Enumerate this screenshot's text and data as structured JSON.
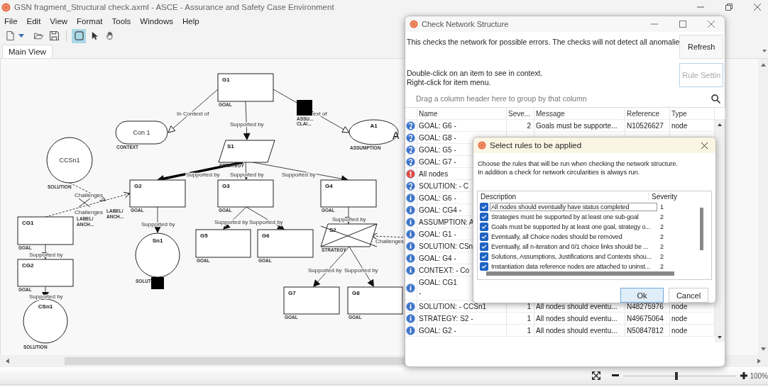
{
  "window": {
    "title": "GSN fragment_Structural check.axml - ASCE - Assurance and Safety Case Environment"
  },
  "menu": [
    "File",
    "Edit",
    "View",
    "Format",
    "Tools",
    "Windows",
    "Help"
  ],
  "toolbar": [
    {
      "kind": "new",
      "selected": false
    },
    {
      "kind": "open",
      "selected": false
    },
    {
      "kind": "save",
      "selected": false
    },
    {
      "kind": "rectangle",
      "selected": true
    },
    {
      "kind": "pointer",
      "selected": false
    },
    {
      "kind": "hand",
      "selected": false
    }
  ],
  "tabs": [
    {
      "label": "Main View",
      "selected": true
    }
  ],
  "diagram": {
    "nodes": [
      {
        "kind": "goal",
        "id": "G1",
        "type": "GOAL",
        "struck": false
      },
      {
        "kind": "context",
        "id": "Con 1",
        "type": "CONTEXT",
        "struck": false
      },
      {
        "kind": "marker",
        "lines": [
          "ASSU...",
          "CLAI..."
        ],
        "struck": false
      },
      {
        "kind": "assumption",
        "id": "A1",
        "type": "ASSUMPTION",
        "mark": "A",
        "struck": false
      },
      {
        "kind": "strategy",
        "id": "S1",
        "type": "STRATEGY",
        "struck": false
      },
      {
        "kind": "solution_ref",
        "id": "CCSn1",
        "type": "SOLUTION",
        "struck": false
      },
      {
        "kind": "goal",
        "id": "G2",
        "type": "GOAL",
        "struck": false
      },
      {
        "kind": "goal",
        "id": "G3",
        "type": "GOAL",
        "struck": false
      },
      {
        "kind": "goal",
        "id": "G4",
        "type": "GOAL",
        "struck": false
      },
      {
        "kind": "goal",
        "id": "CG1",
        "type": "GOAL",
        "struck": false
      },
      {
        "kind": "solution",
        "id": "Sn1",
        "type": "SOLUT",
        "struck": false
      },
      {
        "kind": "goal",
        "id": "G5",
        "type": "GOAL",
        "struck": false
      },
      {
        "kind": "goal",
        "id": "G6",
        "type": "GOAL",
        "struck": false
      },
      {
        "kind": "strategy",
        "id": "S2",
        "type": "STRATEGY",
        "struck": true
      },
      {
        "kind": "goal",
        "id": "CG2",
        "type": "GOAL",
        "struck": false
      },
      {
        "kind": "marker",
        "struck": false
      },
      {
        "kind": "goal",
        "id": "G7",
        "type": "GOAL",
        "struck": false
      },
      {
        "kind": "goal",
        "id": "G8",
        "type": "GOAL",
        "struck": false
      },
      {
        "kind": "solution",
        "id": "CSn1",
        "type": "SOLUTION",
        "struck": false
      }
    ],
    "edges": [
      {
        "kind": "context",
        "label": "In Context of",
        "selected": false
      },
      {
        "kind": "context",
        "label": "ext of",
        "selected": false
      },
      {
        "kind": "support",
        "label": "Supported by",
        "selected": false
      },
      {
        "kind": "support",
        "label": "Supported by",
        "selected": true
      },
      {
        "kind": "support",
        "label": "Supported by",
        "selected": false
      },
      {
        "kind": "support",
        "label": "Supported by",
        "selected": false
      },
      {
        "kind": "support",
        "label": "Supported by",
        "selected": false
      },
      {
        "kind": "support",
        "label": "Supported by",
        "selected": false
      },
      {
        "kind": "support",
        "label": "Supported by",
        "selected": false
      },
      {
        "kind": "support",
        "label": "Supported by",
        "selected": false
      },
      {
        "kind": "support",
        "label": "Supported by",
        "selected": false
      },
      {
        "kind": "support",
        "label": "Supported by",
        "selected": false
      },
      {
        "kind": "support",
        "label": "Supported by",
        "selected": false
      },
      {
        "kind": "support",
        "label": "Supported by",
        "selected": false
      },
      {
        "kind": "challenge",
        "label": "Challenges",
        "selected": false
      },
      {
        "kind": "challenge",
        "label": "Challenges",
        "selected": false
      },
      {
        "kind": "challenge",
        "label": "Challenges",
        "selected": false
      }
    ],
    "anchors": [
      {
        "lines": [
          "LABEL/",
          "ANCH..."
        ]
      },
      {
        "lines": [
          "LABEL/",
          "ANCH..."
        ]
      }
    ]
  },
  "check_dialog": {
    "title": "Check Network Structure",
    "intro": "This checks the network for possible errors. The checks will not detect all anomalie",
    "help": [
      "Double-click on an item to see in context.",
      "Right-click for item menu."
    ],
    "buttons": [
      {
        "label": "Refresh",
        "disabled": false
      },
      {
        "label": "Rule Settin",
        "disabled": true
      }
    ],
    "group_hint": "Drag a column header here to group by that column",
    "columns": [
      "Name",
      "Seve...",
      "Message",
      "Reference",
      "Type"
    ],
    "rows": [
      {
        "kind": "question",
        "name": "GOAL: G6 -",
        "severity": "2",
        "message": "Goals must be supporte...",
        "reference": "N10526627",
        "type": "node"
      },
      {
        "kind": "question",
        "name": "GOAL: G8 -"
      },
      {
        "kind": "question",
        "name": "GOAL: G5 -"
      },
      {
        "kind": "question",
        "name": "GOAL: G7 -"
      },
      {
        "kind": "error",
        "name": "All nodes"
      },
      {
        "kind": "question",
        "name": "SOLUTION:  - C"
      },
      {
        "kind": "info",
        "name": "GOAL: G6 -"
      },
      {
        "kind": "info",
        "name": "GOAL: CG4 -"
      },
      {
        "kind": "info",
        "name": "ASSUMPTION: A"
      },
      {
        "kind": "info",
        "name": "GOAL: G1 -"
      },
      {
        "kind": "info",
        "name": "SOLUTION: CSn"
      },
      {
        "kind": "info",
        "name": "GOAL: G4 -"
      },
      {
        "kind": "info",
        "name": "CONTEXT:  - Co"
      },
      {
        "kind": "info",
        "name": "GOAL: CG1",
        "name_2": "-"
      },
      {
        "kind": "info",
        "name": "SOLUTION:  - CCSn1",
        "severity": "1",
        "message": "All nodes should eventu...",
        "reference": "N48275976",
        "type": "node"
      },
      {
        "kind": "info",
        "name": "STRATEGY: S2 -",
        "severity": "1",
        "message": "All nodes should eventu...",
        "reference": "N49675064",
        "type": "node"
      },
      {
        "kind": "info",
        "name": "GOAL: G2 -",
        "severity": "1",
        "message": "All nodes should eventu...",
        "reference": "N50847812",
        "type": "node"
      }
    ]
  },
  "rules_dialog": {
    "title": "Select rules to be applied",
    "intro": [
      "Choose the rules that will be run when checking the network structure.",
      "In addition a check for network circularities is always run."
    ],
    "columns": [
      "Description",
      "Severity"
    ],
    "rules": [
      {
        "checked": true,
        "description": "All nodes should eventually have status completed",
        "severity": "1",
        "selected": true
      },
      {
        "checked": true,
        "description": "Strategies must be supported by at least one sub-goal",
        "severity": "2",
        "selected": false
      },
      {
        "checked": true,
        "description": "Goals must be supported by at least one goal, strategy o...",
        "severity": "2",
        "selected": false
      },
      {
        "checked": true,
        "description": "Eventually, all Choice nodes should be removed",
        "severity": "2",
        "selected": false
      },
      {
        "checked": true,
        "description": "Eventually, all n-iteration and 0/1 choice links should be ...",
        "severity": "2",
        "selected": false
      },
      {
        "checked": true,
        "description": "Solutions, Assumptions, Justifications and Contexts shou...",
        "severity": "2",
        "selected": false
      },
      {
        "checked": true,
        "description": "Instantiation data reference nodes are attached to uninst...",
        "severity": "2",
        "selected": false
      }
    ],
    "buttons": [
      {
        "label": "Ok",
        "selected": true
      },
      {
        "label": "Cancel",
        "selected": false
      }
    ]
  },
  "zoom": {
    "level": 0.47,
    "reading": "100%"
  }
}
